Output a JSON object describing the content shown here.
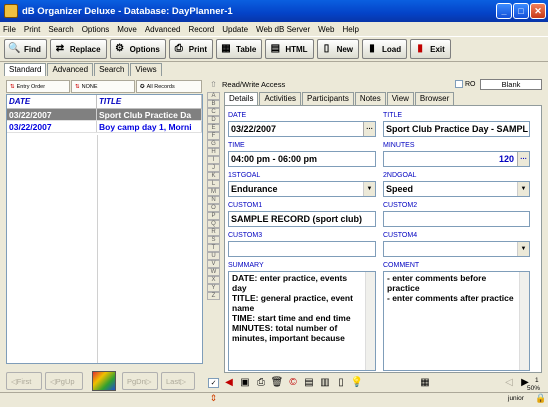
{
  "window": {
    "title": "dB Organizer Deluxe - Database: DayPlanner-1"
  },
  "menu": [
    "File",
    "Print",
    "Search",
    "Options",
    "Move",
    "Advanced",
    "Record",
    "Update",
    "Web dB Server",
    "Web",
    "Help"
  ],
  "toolbar": {
    "find": "Find",
    "replace": "Replace",
    "options": "Options",
    "print": "Print",
    "table": "Table",
    "html": "HTML",
    "new": "New",
    "load": "Load",
    "exit": "Exit"
  },
  "left_tabs": [
    "Standard",
    "Advanced",
    "Search",
    "Views"
  ],
  "sort_buttons": [
    "Entry Order",
    "NONE",
    "All Records"
  ],
  "list": {
    "headers": [
      "DATE",
      "TITLE"
    ],
    "rows": [
      {
        "date": "03/22/2007",
        "title": "Sport Club Practice Da"
      },
      {
        "date": "03/22/2007",
        "title": "Boy camp day 1, Morni"
      }
    ]
  },
  "nav": {
    "first": "First",
    "pgup": "PgUp",
    "pgdn": "PgDn",
    "last": "Last"
  },
  "alpha": [
    "A",
    "B",
    "C",
    "D",
    "E",
    "F",
    "G",
    "H",
    "I",
    "J",
    "K",
    "L",
    "M",
    "N",
    "O",
    "P",
    "Q",
    "R",
    "S",
    "T",
    "U",
    "V",
    "W",
    "X",
    "Y",
    "Z"
  ],
  "right": {
    "rw": "Read/Write Access",
    "ro": "RO",
    "blank": "Blank",
    "tabs": [
      "Details",
      "Activities",
      "Participants",
      "Notes",
      "View",
      "Browser"
    ]
  },
  "form": {
    "date_label": "DATE",
    "date": "03/22/2007",
    "title_label": "TITLE",
    "title": "Sport Club Practice Day - SAMPL",
    "time_label": "TIME",
    "time": "04:00 pm - 06:00 pm",
    "minutes_label": "MINUTES",
    "minutes": "120",
    "goal1_label": "1STGOAL",
    "goal1": "Endurance",
    "goal2_label": "2NDGOAL",
    "goal2": "Speed",
    "custom1_label": "CUSTOM1",
    "custom1": "SAMPLE RECORD (sport club)",
    "custom2_label": "CUSTOM2",
    "custom2": "",
    "custom3_label": "CUSTOM3",
    "custom3": "",
    "custom4_label": "CUSTOM4",
    "custom4": "",
    "summary_label": "SUMMARY",
    "summary": "DATE: enter practice, events day\nTITLE: general practice, event name\nTIME: start time and end time\nMINUTES: total number of minutes, important because",
    "comment_label": "COMMENT",
    "comment": "- enter comments before practice\n- enter comments after practice"
  },
  "status": {
    "count": "1",
    "zoom": "50%",
    "user": "junior"
  }
}
